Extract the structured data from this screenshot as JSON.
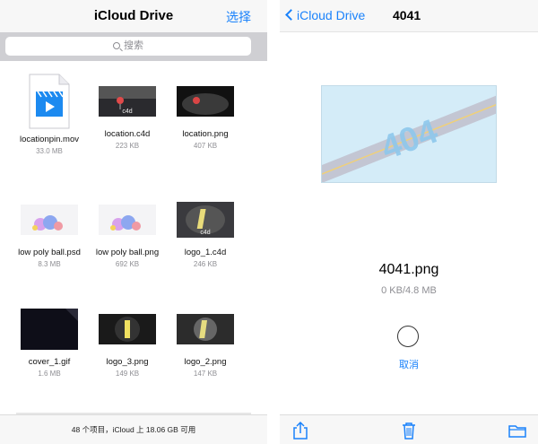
{
  "left": {
    "nav": {
      "title": "iCloud Drive",
      "action": "选择"
    },
    "search": {
      "placeholder": "搜索",
      "icon": "search-icon"
    },
    "files": [
      {
        "name": "locationpin.mov",
        "size": "33.0 MB",
        "kind": "video"
      },
      {
        "name": "location.c4d",
        "size": "223 KB",
        "kind": "pin-c4d",
        "badge": "c4d"
      },
      {
        "name": "location.png",
        "size": "407 KB",
        "kind": "pin-png"
      },
      {
        "name": "low poly ball.psd",
        "size": "8.3 MB",
        "kind": "balls"
      },
      {
        "name": "low poly ball.png",
        "size": "692 KB",
        "kind": "balls"
      },
      {
        "name": "logo_1.c4d",
        "size": "246 KB",
        "kind": "logo-c4d",
        "badge": "c4d"
      },
      {
        "name": "cover_1.gif",
        "size": "1.6 MB",
        "kind": "cover"
      },
      {
        "name": "logo_3.png",
        "size": "149 KB",
        "kind": "logo-dark"
      },
      {
        "name": "logo_2.png",
        "size": "147 KB",
        "kind": "logo-gray"
      }
    ],
    "status": "48 个项目，iCloud 上 18.06 GB 可用"
  },
  "right": {
    "nav": {
      "back_label": "iCloud Drive",
      "title": "4041"
    },
    "preview_text": "404",
    "file": {
      "name": "4041.png",
      "progress_text": "0 KB/4.8 MB",
      "progress": 0
    },
    "cancel": "取消",
    "toolbar": [
      "share-icon",
      "trash-icon",
      "folder-icon"
    ],
    "accent": "#1a82fb"
  }
}
